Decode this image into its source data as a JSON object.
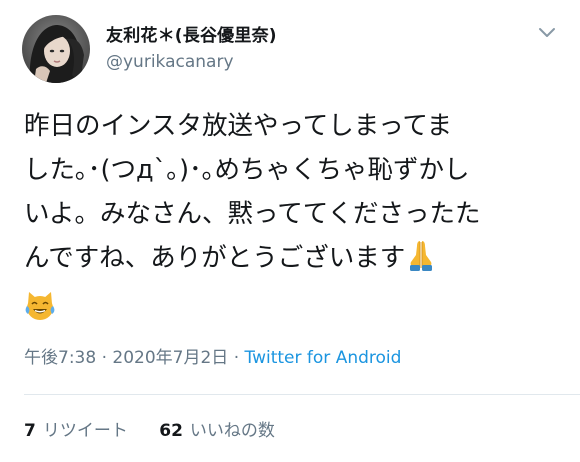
{
  "author": {
    "display_name": "友利花＊(長谷優里奈)",
    "handle": "@yurikacanary"
  },
  "tweet": {
    "lines": [
      "昨日のインスタ放送やってしまってま",
      "した｡･(つд`｡)･｡めちゃくちゃ恥ずかし",
      "いよ。みなさん、黙っててくださったた",
      "んですね、ありがとうございます"
    ],
    "emojis": [
      "folded-hands-emoji",
      "cat-tears-of-joy-emoji"
    ]
  },
  "meta": {
    "time": "午後7:38",
    "separator1": "·",
    "date": "2020年7月2日",
    "separator2": "·",
    "source": "Twitter for Android"
  },
  "stats": {
    "retweets_count": "7",
    "retweets_label": "リツイート",
    "likes_count": "62",
    "likes_label": "いいねの数"
  },
  "colors": {
    "text": "#14171a",
    "secondary": "#657786",
    "link": "#1b95e0",
    "divider": "#e1e8ed"
  }
}
